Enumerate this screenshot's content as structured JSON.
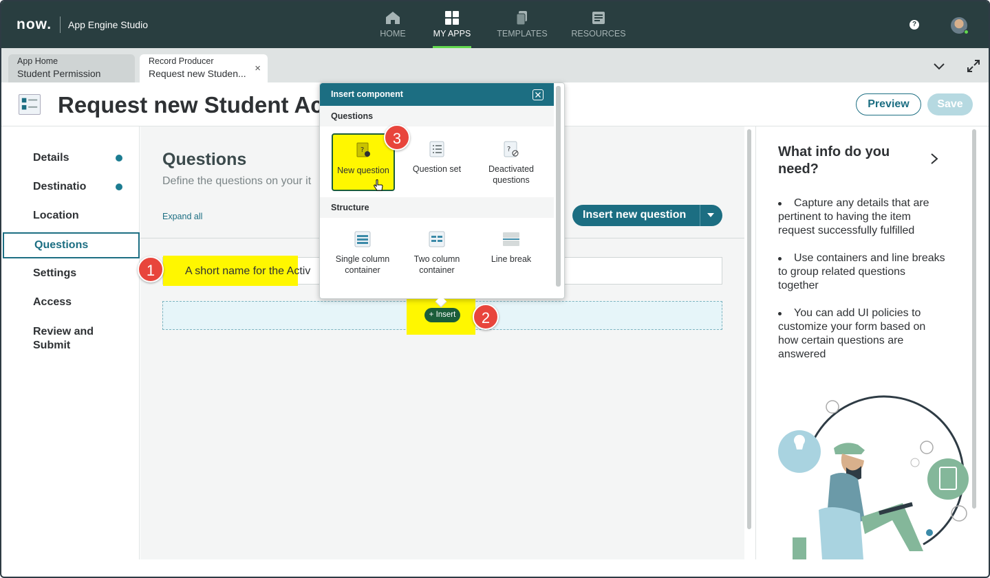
{
  "topnav": {
    "logo": "now.",
    "app_name": "App Engine Studio",
    "items": [
      {
        "label": "HOME",
        "icon": "home-icon"
      },
      {
        "label": "MY APPS",
        "icon": "grid-icon"
      },
      {
        "label": "TEMPLATES",
        "icon": "templates-icon"
      },
      {
        "label": "RESOURCES",
        "icon": "resources-icon"
      }
    ],
    "active": "MY APPS",
    "help": "?"
  },
  "tabs": [
    {
      "type": "App Home",
      "name": "Student Permission"
    },
    {
      "type": "Record Producer",
      "name": "Request new Studen...",
      "close": "×"
    }
  ],
  "page": {
    "title": "Request new Student Ac",
    "preview_label": "Preview",
    "save_label": "Save"
  },
  "leftnav": {
    "items": [
      {
        "label": "Details",
        "complete": true
      },
      {
        "label": "Destinatio",
        "complete": true
      },
      {
        "label": "Location",
        "complete": false
      },
      {
        "label": "Questions",
        "complete": false
      },
      {
        "label": "Settings",
        "complete": false
      },
      {
        "label": "Access",
        "complete": false
      },
      {
        "label": "Review and Submit",
        "complete": false
      }
    ],
    "active": "Questions"
  },
  "main": {
    "title": "Questions",
    "subtitle": "Define the questions on your it",
    "expand_all": "Expand all",
    "insert_new_question": "Insert new question",
    "question_text": "A short name for the Activ",
    "insert_button": "+ Insert"
  },
  "callouts": [
    "1",
    "2",
    "3"
  ],
  "popup": {
    "title": "Insert component",
    "sections": [
      {
        "label": "Questions",
        "items": [
          {
            "label": "New question",
            "icon": "new-question-icon"
          },
          {
            "label": "Question set",
            "icon": "question-set-icon"
          },
          {
            "label": "Deactivated questions",
            "icon": "deactivated-questions-icon"
          }
        ]
      },
      {
        "label": "Structure",
        "items": [
          {
            "label": "Single column container",
            "icon": "single-column-icon"
          },
          {
            "label": "Two column container",
            "icon": "two-column-icon"
          },
          {
            "label": "Line break",
            "icon": "line-break-icon"
          }
        ]
      }
    ]
  },
  "rightpanel": {
    "title": "What info do you need?",
    "tips": [
      "Capture any details that are pertinent to having the item request successfully fulfilled",
      "Use containers and line breaks to group related questions together",
      "You can add UI policies to customize your form based on how certain questions are answered"
    ]
  },
  "colors": {
    "nav_bg": "#293e40",
    "accent": "#1c6e82",
    "highlight": "#fff700",
    "callout": "#e8453c",
    "complete_dot": "#1c7c91"
  }
}
